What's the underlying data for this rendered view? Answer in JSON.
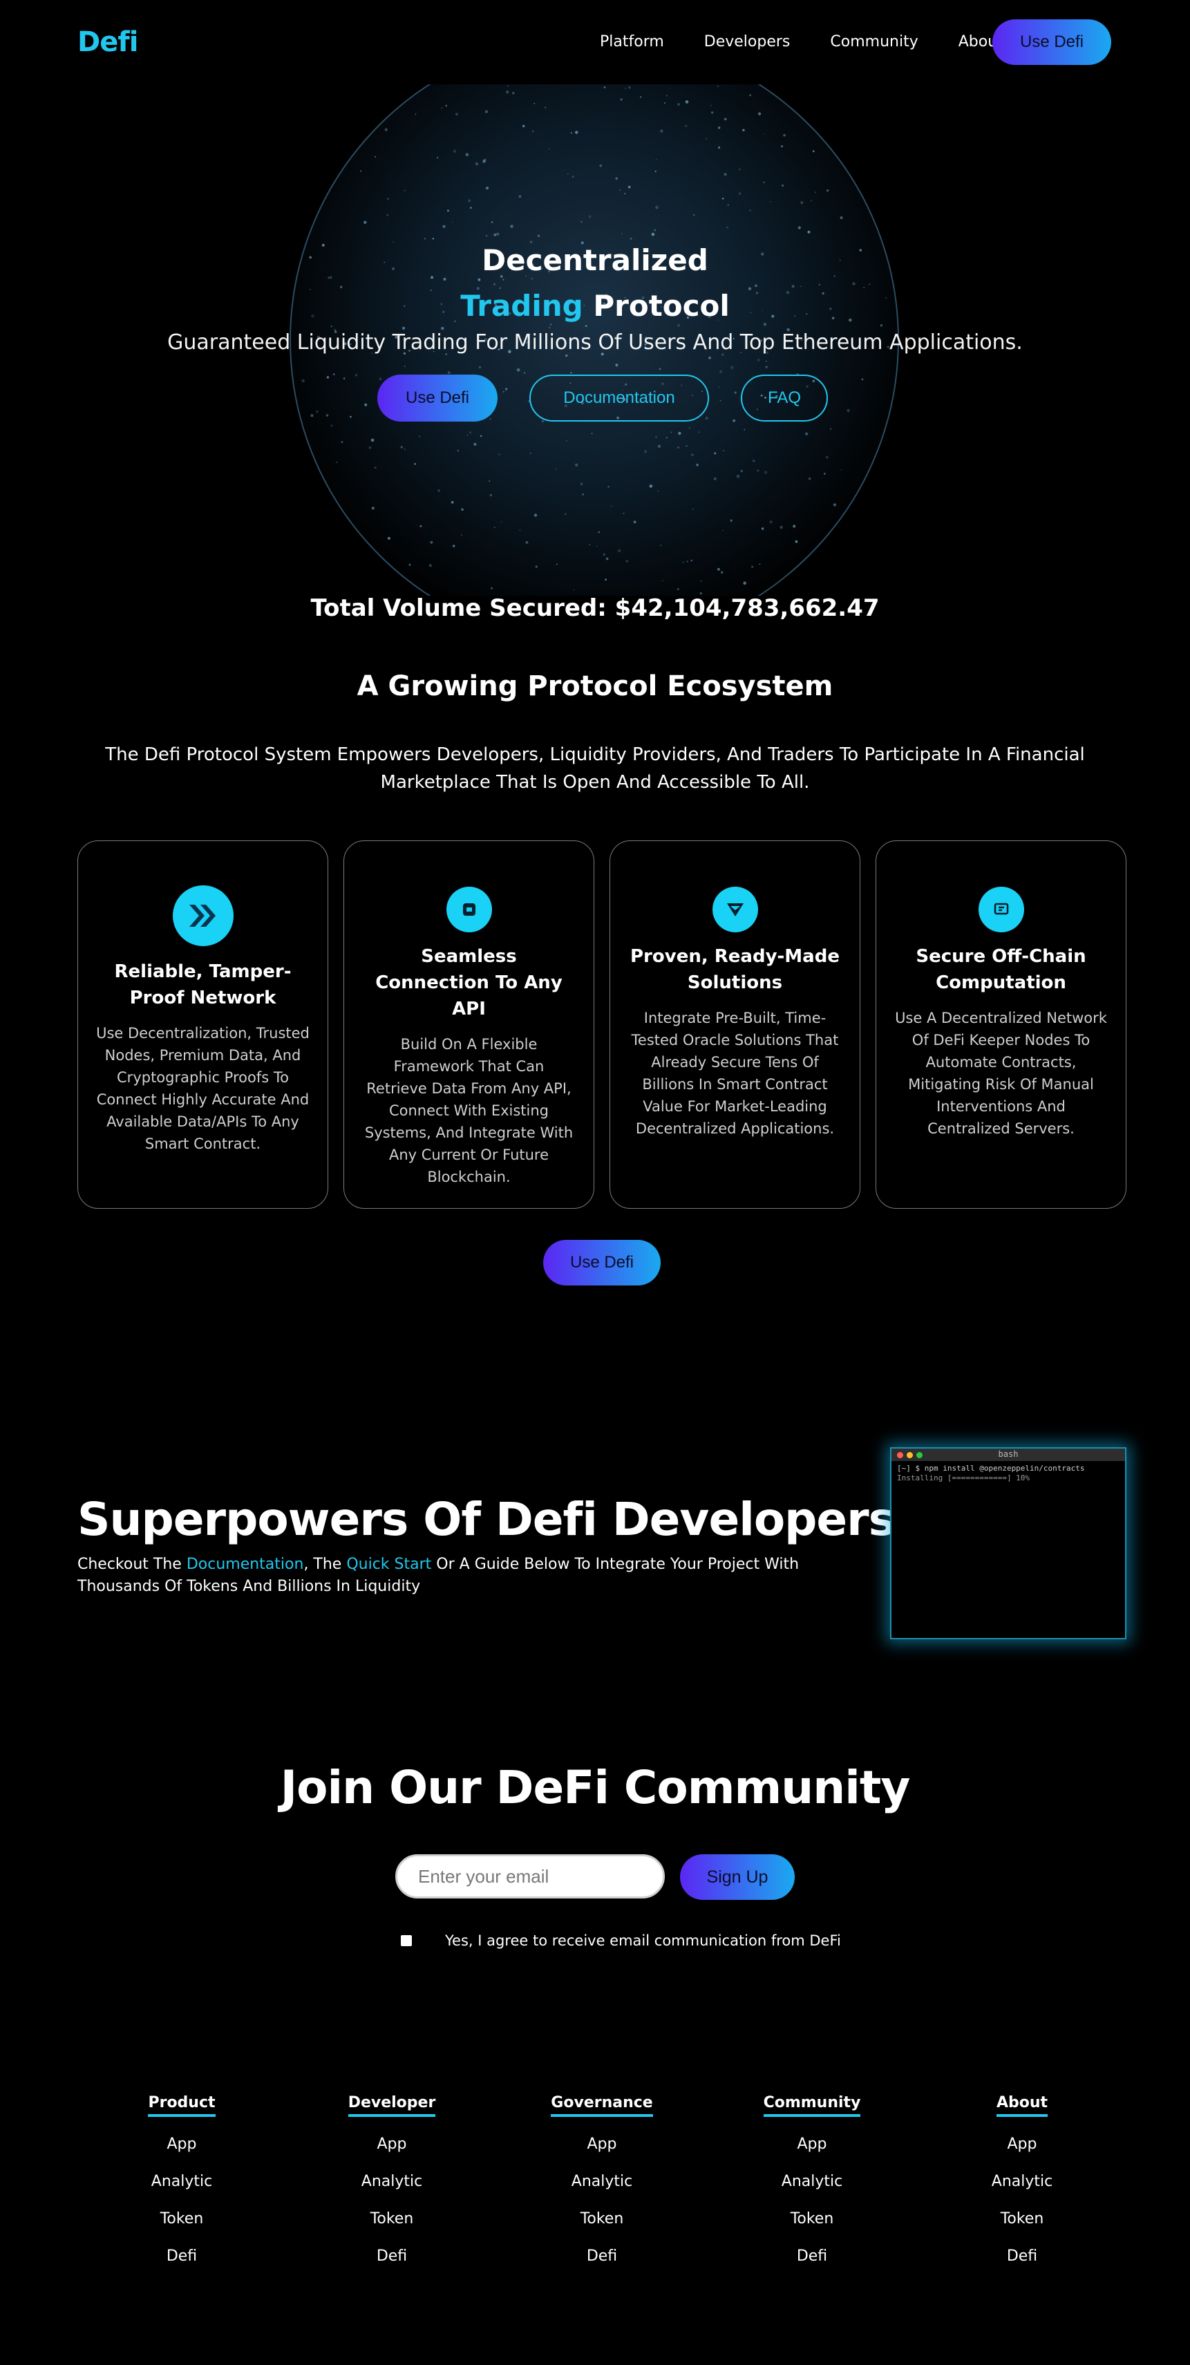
{
  "nav": {
    "logo": "Defi",
    "links": [
      "Platform",
      "Developers",
      "Community",
      "About"
    ],
    "cta": "Use Defi"
  },
  "hero": {
    "title_line1": "Decentralized",
    "title_accent": "Trading",
    "title_rest": " Protocol",
    "subtitle": "Guaranteed Liquidity Trading For Millions Of Users And Top Ethereum Applications.",
    "btn_primary": "Use Defi",
    "btn_docs": "Documentation",
    "btn_faq": "FAQ",
    "volume": "Total Volume Secured: $42,104,783,662.47"
  },
  "ecosystem": {
    "title": "A Growing Protocol Ecosystem",
    "description": "The Defi Protocol System Empowers Developers, Liquidity Providers, And Traders To Participate In A Financial Marketplace That Is Open And Accessible To All.",
    "cards": [
      {
        "icon": "chevrons-icon",
        "title": "Reliable, Tamper-Proof Network",
        "text": "Use Decentralization, Trusted Nodes, Premium Data, And Cryptographic Proofs To Connect Highly Accurate And Available Data/APIs To Any Smart Contract."
      },
      {
        "icon": "api-icon",
        "title": "Seamless Connection To Any API",
        "text": "Build On A Flexible Framework That Can Retrieve Data From Any API, Connect With Existing Systems, And Integrate With Any Current Or Future Blockchain."
      },
      {
        "icon": "shield-icon",
        "title": "Proven, Ready-Made Solutions",
        "text": "Integrate Pre-Built, Time-Tested Oracle Solutions That Already Secure Tens Of Billions In Smart Contract Value For Market-Leading Decentralized Applications."
      },
      {
        "icon": "compute-icon",
        "title": "Secure Off-Chain Computation",
        "text": "Use A Decentralized Network Of DeFi Keeper Nodes To Automate Contracts, Mitigating Risk Of Manual Interventions And Centralized Servers."
      }
    ],
    "cta": "Use Defi"
  },
  "superpowers": {
    "title": "Superpowers Of Defi Developers",
    "desc_pre": "Checkout The ",
    "desc_link1": "Documentation",
    "desc_mid": ", The ",
    "desc_link2": "Quick Start",
    "desc_post": " Or A Guide Below To Integrate Your Project With Thousands Of Tokens And Billions In Liquidity",
    "terminal": {
      "title": "bash",
      "line1": "[~] $ npm install @openzeppelin/contracts",
      "line2": "Installing [============] 10%"
    }
  },
  "community": {
    "title": "Join Our DeFi Community",
    "email_placeholder": "Enter your email",
    "signup": "Sign Up",
    "consent": "Yes, I agree to receive email communication from DeFi"
  },
  "footer": {
    "columns": [
      {
        "heading": "Product",
        "items": [
          "App",
          "Analytic",
          "Token",
          "Defi"
        ]
      },
      {
        "heading": "Developer",
        "items": [
          "App",
          "Analytic",
          "Token",
          "Defi"
        ]
      },
      {
        "heading": "Governance",
        "items": [
          "App",
          "Analytic",
          "Token",
          "Defi"
        ]
      },
      {
        "heading": "Community",
        "items": [
          "App",
          "Analytic",
          "Token",
          "Defi"
        ]
      },
      {
        "heading": "About",
        "items": [
          "App",
          "Analytic",
          "Token",
          "Defi"
        ]
      }
    ]
  },
  "colors": {
    "accent": "#22c7ee",
    "gradient_start": "#5b27f2",
    "gradient_end": "#1aa9f0",
    "background": "#000000"
  }
}
